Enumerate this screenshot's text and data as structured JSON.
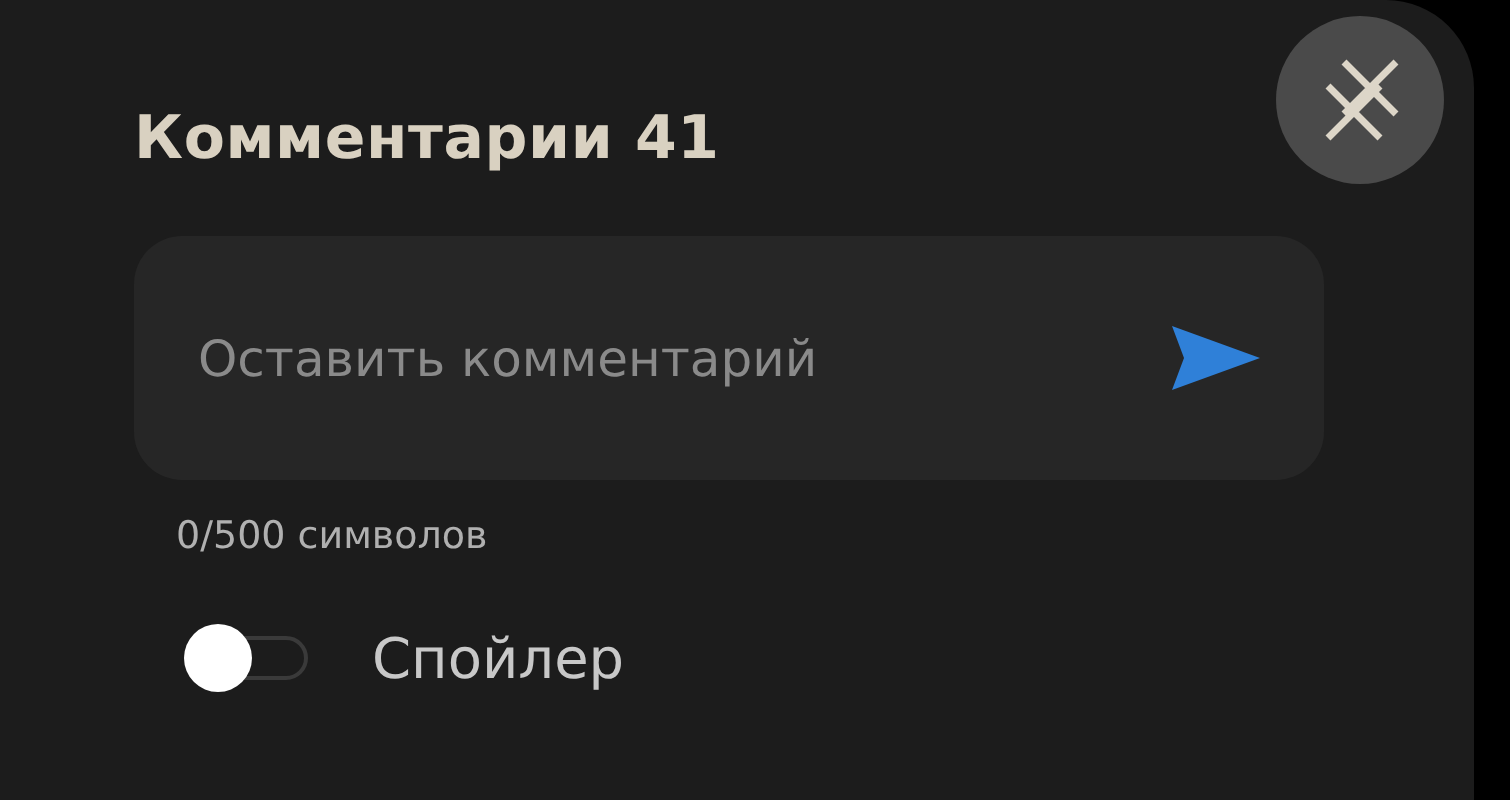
{
  "title": "Комментарии 41",
  "comment_field": {
    "placeholder": "Оставить комментарий"
  },
  "counter": "0/500 символов",
  "spoiler_toggle": {
    "label": "Спойлер",
    "on": false
  }
}
